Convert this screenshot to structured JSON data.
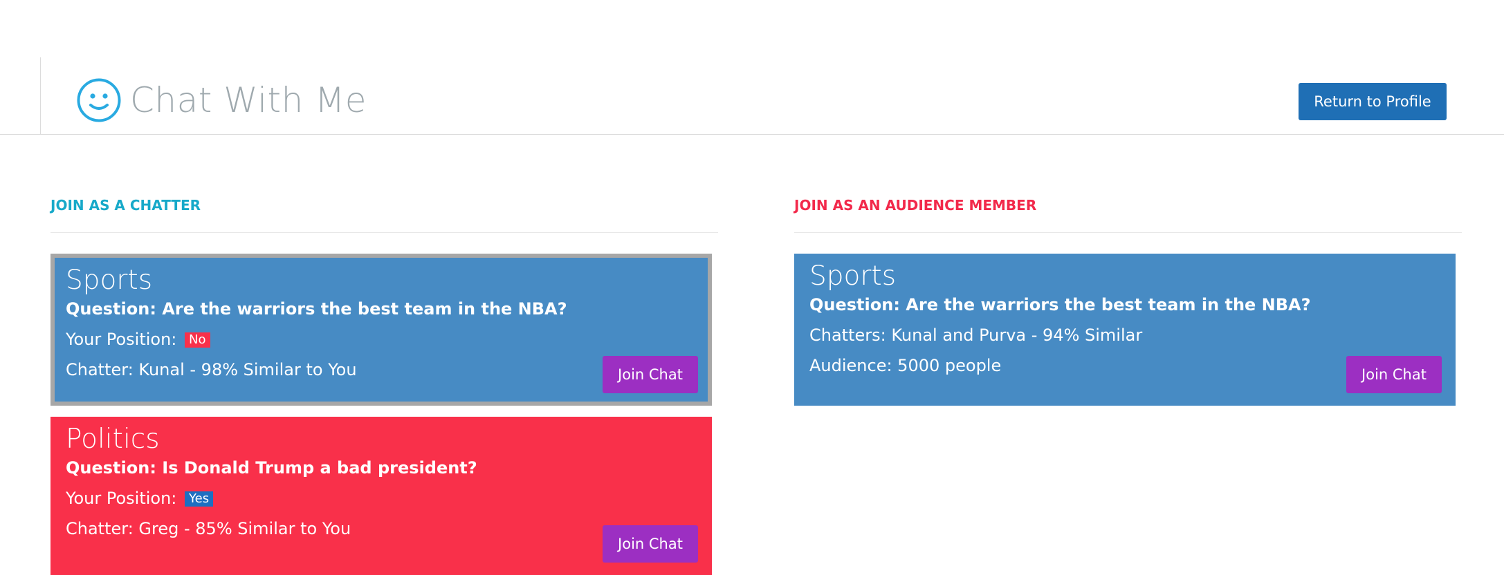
{
  "header": {
    "app_title": "Chat With Me",
    "return_button_label": "Return to Profile",
    "logo_icon": "smiley-icon",
    "colors": {
      "logo": "#29aae1",
      "return_button": "#1f6fb5"
    }
  },
  "chatter_section": {
    "title": "JOIN AS A CHATTER",
    "color": "#17a9c9",
    "cards": [
      {
        "topic": "Sports",
        "question": "Question: Are the warriors the best team in the NBA?",
        "position_label": "Your Position:",
        "position_value": "No",
        "chatter_text": "Chatter: Kunal - 98% Similar to You",
        "join_label": "Join Chat",
        "color": "#478bc4",
        "selected": true
      },
      {
        "topic": "Politics",
        "question": "Question: Is Donald Trump a bad president?",
        "position_label": "Your Position:",
        "position_value": "Yes",
        "chatter_text": "Chatter: Greg - 85% Similar to You",
        "join_label": "Join Chat",
        "color": "#f9304a",
        "selected": false
      }
    ]
  },
  "audience_section": {
    "title": "JOIN AS AN AUDIENCE MEMBER",
    "color": "#f2294b",
    "cards": [
      {
        "topic": "Sports",
        "question": "Question: Are the warriors the best team in the NBA?",
        "chatters_text": "Chatters: Kunal and Purva - 94% Similar",
        "audience_text": "Audience: 5000 people",
        "join_label": "Join Chat",
        "color": "#478bc4"
      }
    ]
  },
  "join_button_color": "#9c2fc2"
}
